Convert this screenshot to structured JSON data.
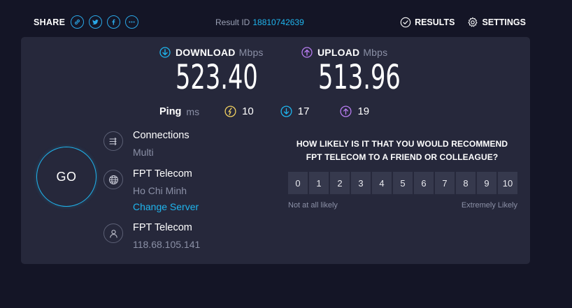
{
  "share": {
    "label": "SHARE",
    "buttons": [
      "link-icon",
      "twitter-icon",
      "facebook-icon",
      "more-icon"
    ]
  },
  "result": {
    "label": "Result ID",
    "id": "18810742639"
  },
  "nav": {
    "results": "RESULTS",
    "settings": "SETTINGS"
  },
  "download": {
    "label": "DOWNLOAD",
    "unit": "Mbps",
    "value": "523.40"
  },
  "upload": {
    "label": "UPLOAD",
    "unit": "Mbps",
    "value": "513.96"
  },
  "ping": {
    "label": "Ping",
    "unit": "ms",
    "idle": "10",
    "down": "17",
    "up": "19"
  },
  "go": {
    "label": "GO"
  },
  "connections": {
    "title": "Connections",
    "value": "Multi"
  },
  "server": {
    "title": "FPT Telecom",
    "location": "Ho Chi Minh",
    "change_label": "Change Server"
  },
  "isp": {
    "title": "FPT Telecom",
    "ip": "118.68.105.141"
  },
  "survey": {
    "question_line1": "HOW LIKELY IS IT THAT YOU WOULD RECOMMEND",
    "question_line2": "FPT TELECOM TO A FRIEND OR COLLEAGUE?",
    "scale": [
      "0",
      "1",
      "2",
      "3",
      "4",
      "5",
      "6",
      "7",
      "8",
      "9",
      "10"
    ],
    "low_label": "Not at all likely",
    "high_label": "Extremely Likely"
  },
  "colors": {
    "background": "#141526",
    "panel": "#26283b",
    "accent_cyan": "#1fb5ee",
    "upload_purple": "#b77cf0",
    "ping_yellow": "#f0d060"
  }
}
